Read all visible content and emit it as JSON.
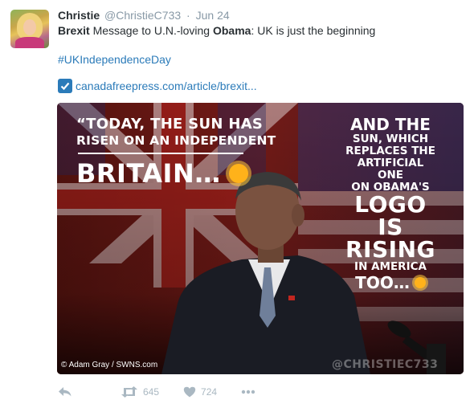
{
  "tweet": {
    "fullname": "Christie",
    "handle": "@ChristieC733",
    "separator": "·",
    "time": "Jun 24",
    "text_part1": "Brexit",
    "text_part2": " Message to U.N.-loving ",
    "text_part3": "Obama",
    "text_part4": ": UK is just the beginning",
    "hashtag": "#UKIndependenceDay",
    "link": "canadafreepress.com/article/brexit..."
  },
  "media": {
    "quote_left_line1": "“TODAY, THE SUN HAS",
    "quote_left_line2": "RISEN ON AN INDEPENDENT",
    "quote_left_line3": "BRITAIN…",
    "quote_right_line1": "AND THE",
    "quote_right_line2": "SUN, WHICH\nREPLACES THE\nARTIFICIAL ONE\nON OBAMA'S",
    "quote_right_line3": "LOGO IS\nRISING",
    "quote_right_line4": "IN AMERICA",
    "quote_right_line5": "TOO…",
    "credit": "© Adam Gray / SWNS.com",
    "watermark": "@CHRISTIEC733"
  },
  "actions": {
    "retweets": "645",
    "likes": "724"
  },
  "colors": {
    "link": "#2b7bb9",
    "muted": "#8899a6",
    "icon": "#aab8c2"
  },
  "icons": [
    "reply-icon",
    "retweet-icon",
    "heart-icon",
    "more-icon",
    "checkbox-icon",
    "sun-icon"
  ]
}
